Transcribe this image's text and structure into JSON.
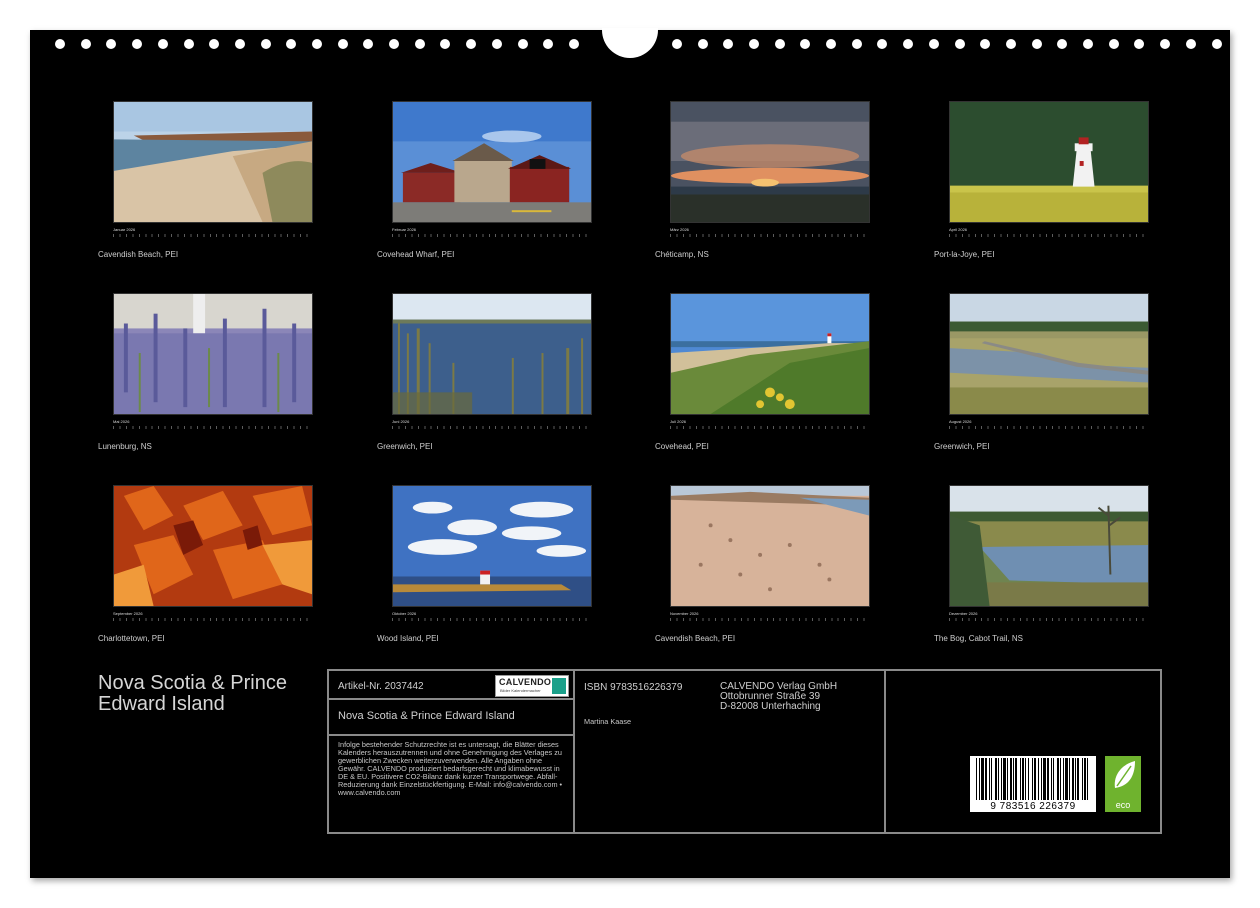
{
  "months": [
    {
      "label": "Januar 2026",
      "caption": "Cavendish Beach, PEI"
    },
    {
      "label": "Februar 2026",
      "caption": "Covehead Wharf, PEI"
    },
    {
      "label": "März 2026",
      "caption": "Chéticamp, NS"
    },
    {
      "label": "April 2026",
      "caption": "Port-la-Joye, PEI"
    },
    {
      "label": "Mai 2026",
      "caption": "Lunenburg, NS"
    },
    {
      "label": "Juni 2026",
      "caption": "Greenwich, PEI"
    },
    {
      "label": "Juli 2026",
      "caption": "Covehead, PEI"
    },
    {
      "label": "August 2026",
      "caption": "Greenwich, PEI"
    },
    {
      "label": "September 2026",
      "caption": "Charlottetown, PEI"
    },
    {
      "label": "Oktober 2026",
      "caption": "Wood Island, PEI"
    },
    {
      "label": "November 2026",
      "caption": "Cavendish Beach, PEI"
    },
    {
      "label": "Dezember 2026",
      "caption": "The Bog, Cabot Trail, NS"
    }
  ],
  "calendar_title": "Nova Scotia & Prince Edward Island",
  "info": {
    "article_no": "Artikel-Nr. 2037442",
    "logo_text": "CALVENDO",
    "logo_sub": "Bilder Kalendermacher",
    "product_title": "Nova Scotia & Prince Edward Island",
    "legal_text": "Infolge bestehender Schutzrechte ist es untersagt, die Blätter dieses Kalenders herauszutrennen und ohne Genehmigung des Verlages zu gewerblichen Zwecken weiterzuverwenden. Alle Angaben ohne Gewähr. CALVENDO produziert bedarfsgerecht und klimabewusst in DE & EU. Positivere CO2-Bilanz dank kurzer Transportwege. Abfall-Reduzierung dank Einzelstückfertigung. E-Mail: info@calvendo.com • www.calvendo.com",
    "isbn": "ISBN 9783516226379",
    "author": "Martina Kaase",
    "publisher_name": "CALVENDO Verlag GmbH",
    "publisher_street": "Ottobrunner Straße 39",
    "publisher_city": "D-82008 Unterhaching",
    "barcode_digits": "9 783516 226379",
    "eco_label": "eco"
  }
}
